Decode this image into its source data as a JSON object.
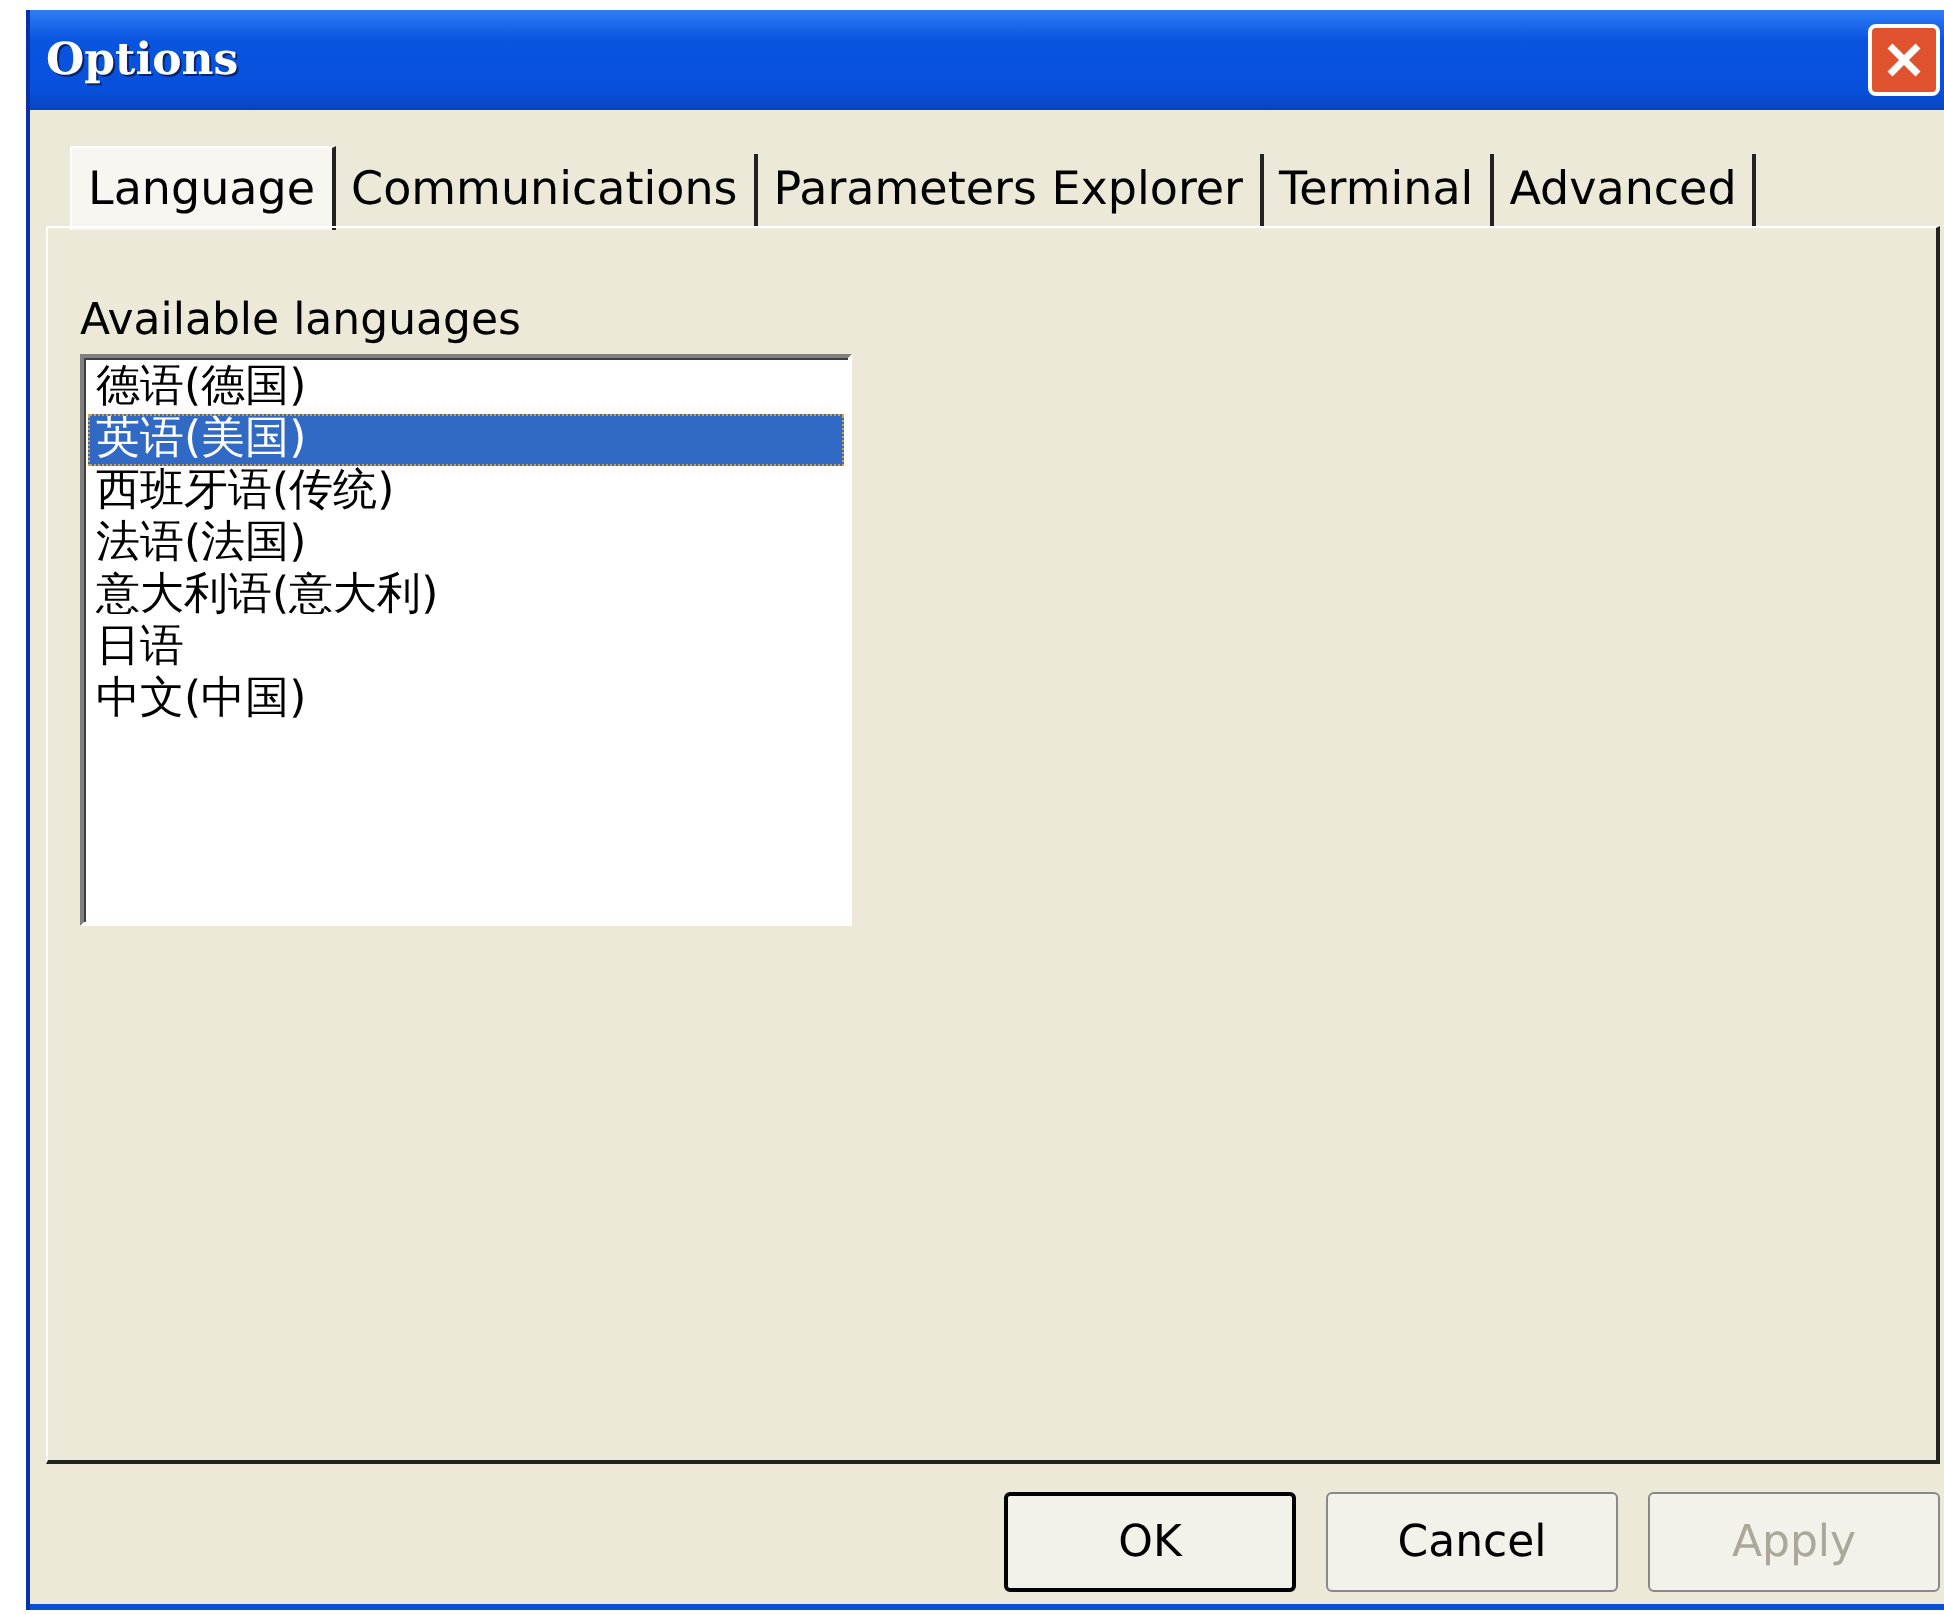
{
  "window": {
    "title": "Options"
  },
  "tabs": [
    {
      "label": "Language",
      "selected": true
    },
    {
      "label": "Communications",
      "selected": false
    },
    {
      "label": "Parameters Explorer",
      "selected": false
    },
    {
      "label": "Terminal",
      "selected": false
    },
    {
      "label": "Advanced",
      "selected": false
    }
  ],
  "languages": {
    "label": "Available languages",
    "items": [
      {
        "label": "德语(德国)",
        "selected": false
      },
      {
        "label": "英语(美国)",
        "selected": true
      },
      {
        "label": "西班牙语(传统)",
        "selected": false
      },
      {
        "label": "法语(法国)",
        "selected": false
      },
      {
        "label": "意大利语(意大利)",
        "selected": false
      },
      {
        "label": "日语",
        "selected": false
      },
      {
        "label": "中文(中国)",
        "selected": false
      }
    ]
  },
  "buttons": [
    {
      "label": "OK",
      "default": true,
      "disabled": false
    },
    {
      "label": "Cancel",
      "default": false,
      "disabled": false
    },
    {
      "label": "Apply",
      "default": false,
      "disabled": true
    }
  ]
}
